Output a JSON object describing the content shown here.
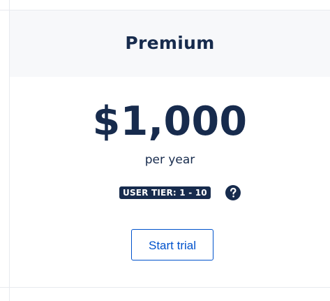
{
  "plan": {
    "title": "Premium",
    "price": "$1,000",
    "period": "per year",
    "tier_badge": "USER TIER: 1 - 10",
    "cta_label": "Start trial"
  },
  "icons": {
    "help": "question-circle-icon"
  },
  "colors": {
    "text_primary": "#172b4d",
    "header_background": "#f7f8fa",
    "link_blue": "#0052cc",
    "border": "#e7eaef",
    "badge_background": "#172b4d"
  }
}
